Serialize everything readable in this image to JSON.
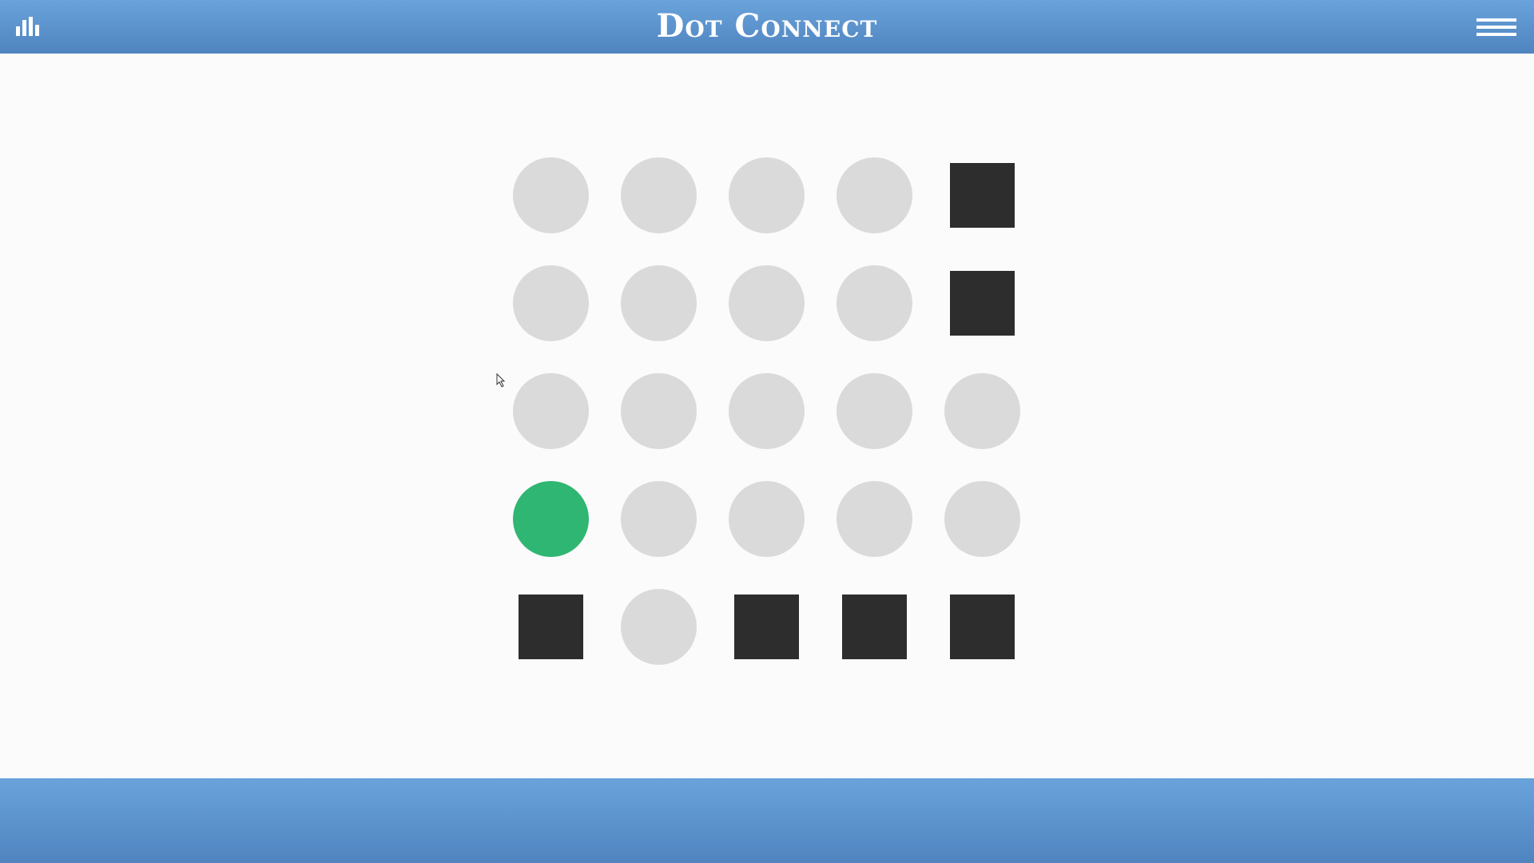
{
  "header": {
    "title": "Dot Connect",
    "stats_icon": "bar-chart-icon",
    "menu_icon": "hamburger-menu-icon"
  },
  "colors": {
    "header": "#5b93cf",
    "dot": "#dadada",
    "dot_active": "#2fb673",
    "block": "#2d2d2d",
    "background": "#fbfbfb"
  },
  "board": {
    "rows": 5,
    "cols": 5,
    "cells": [
      [
        "dot",
        "dot",
        "dot",
        "dot",
        "block"
      ],
      [
        "dot",
        "dot",
        "dot",
        "dot",
        "block"
      ],
      [
        "dot",
        "dot",
        "dot",
        "dot",
        "dot"
      ],
      [
        "active",
        "dot",
        "dot",
        "dot",
        "dot"
      ],
      [
        "block",
        "dot",
        "block",
        "block",
        "block"
      ]
    ]
  }
}
